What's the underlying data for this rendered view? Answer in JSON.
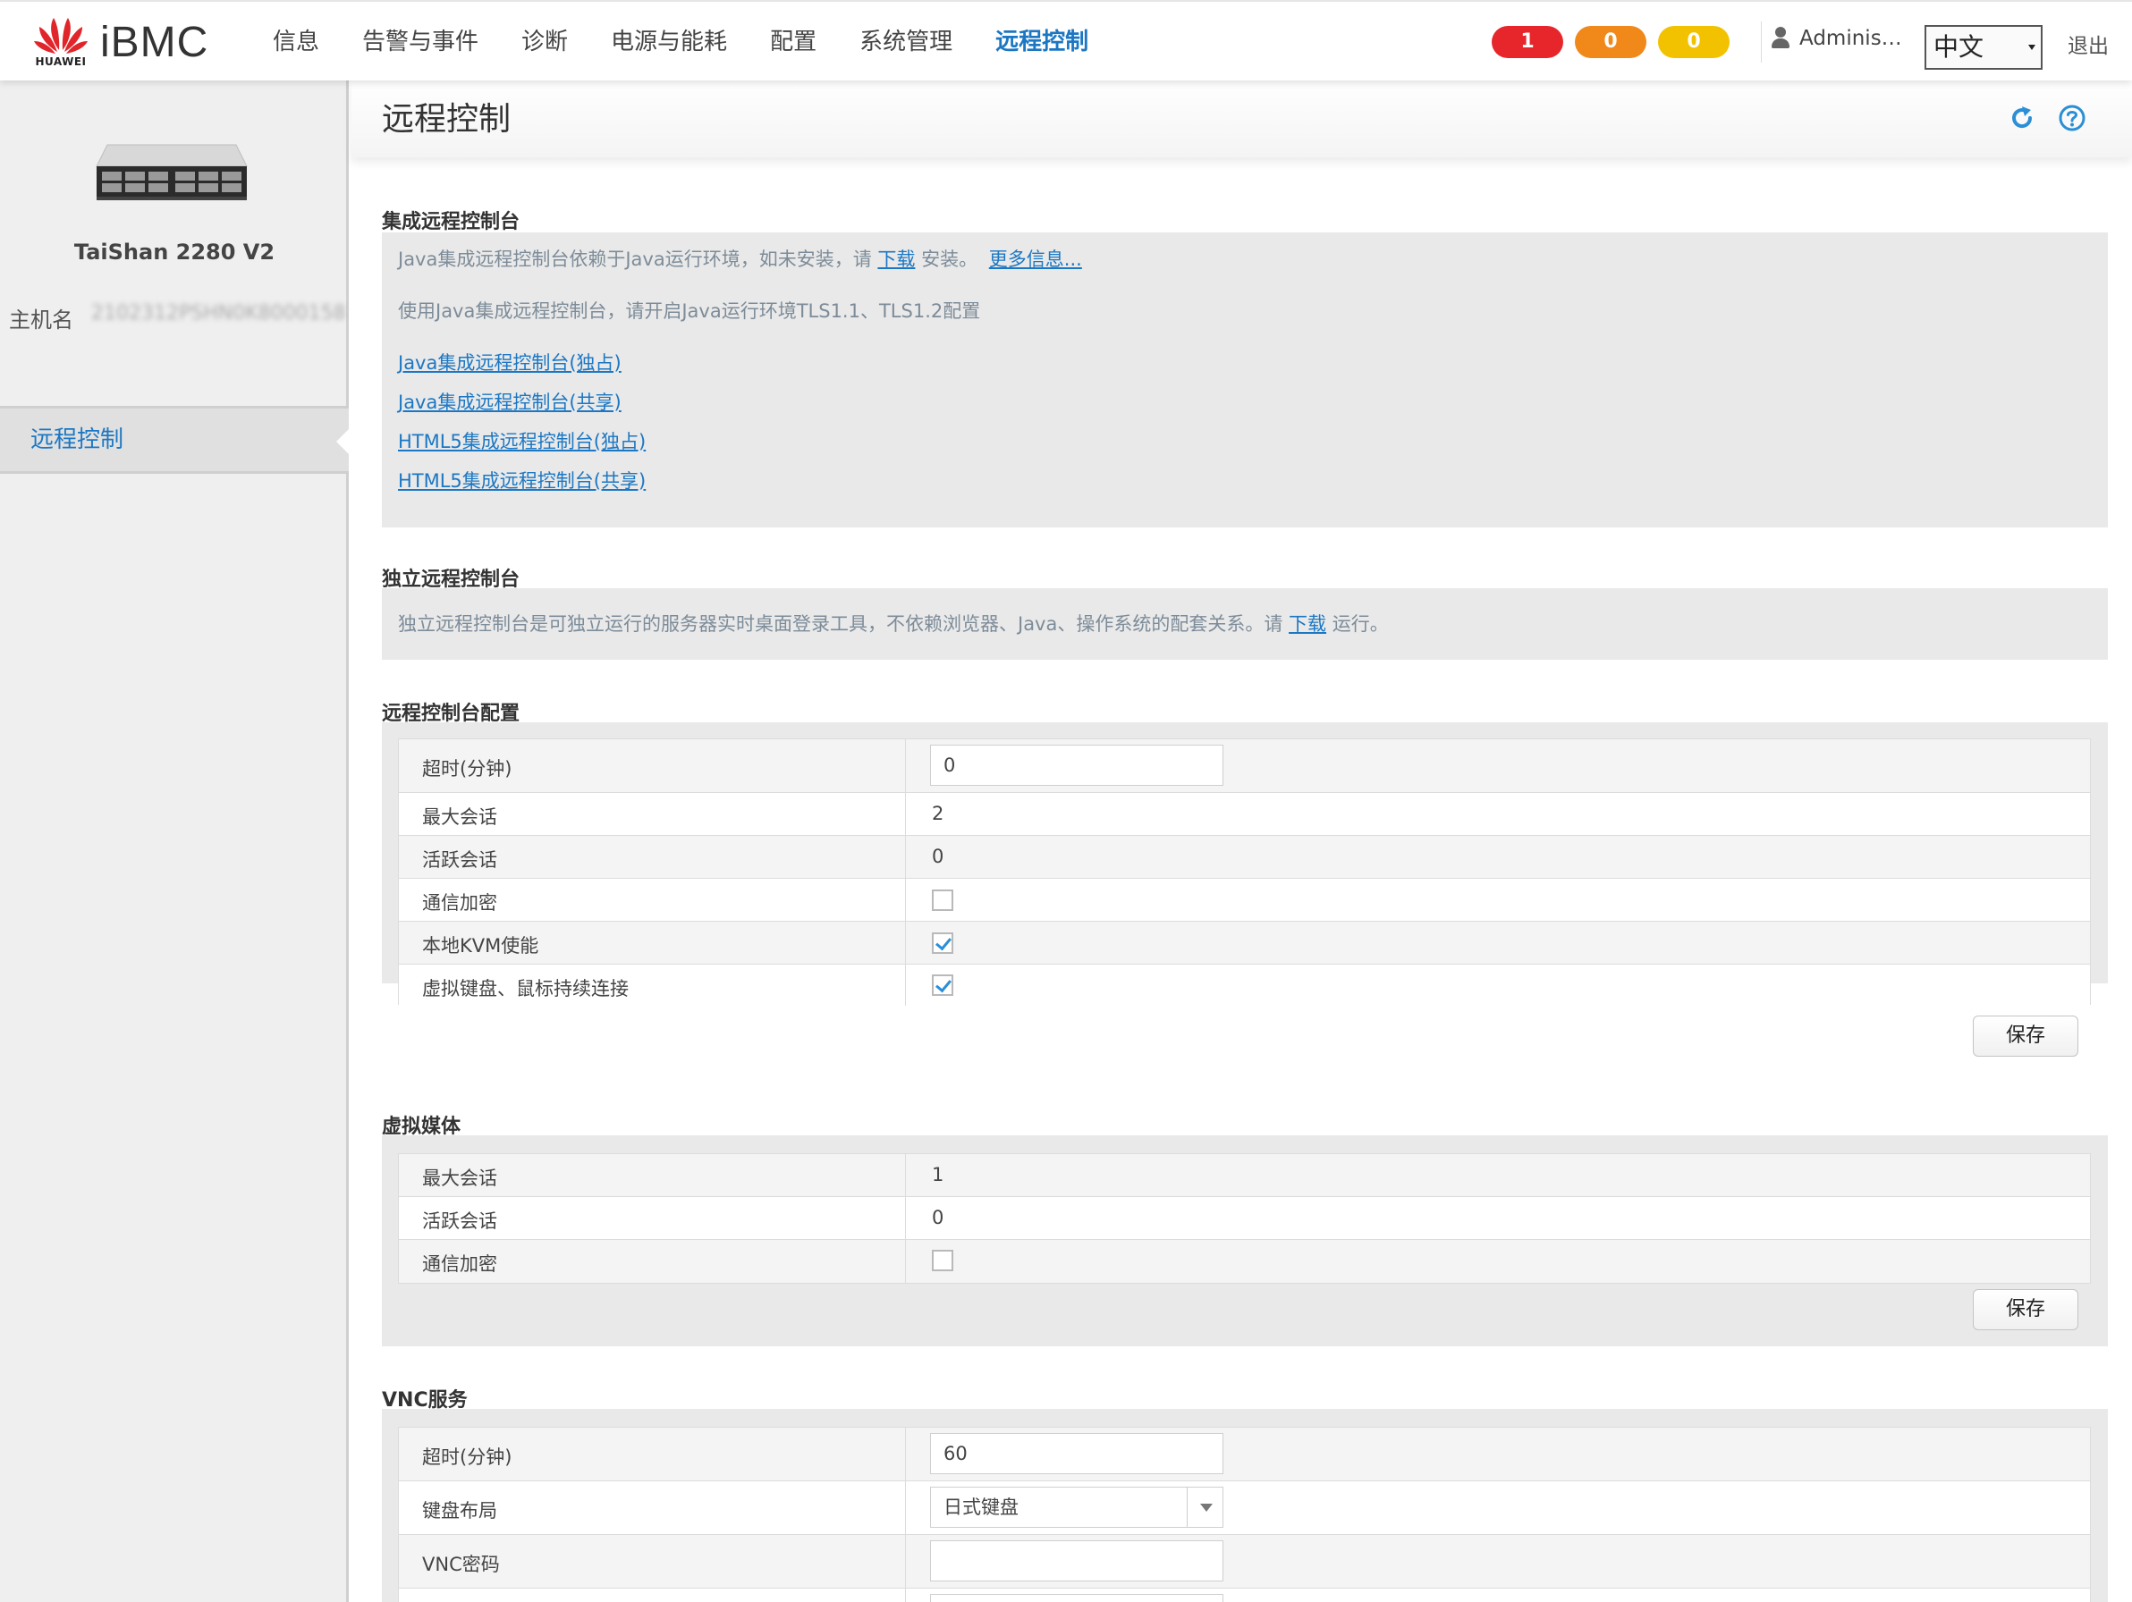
{
  "header": {
    "brand_small": "HUAWEI",
    "brand": "iBMC",
    "nav": [
      "信息",
      "告警与事件",
      "诊断",
      "电源与能耗",
      "配置",
      "系统管理",
      "远程控制"
    ],
    "active_nav_index": 6,
    "alerts": {
      "critical": "1",
      "major": "0",
      "minor": "0"
    },
    "user": "Adminis…",
    "language": "中文",
    "logout": "退出"
  },
  "colors": {
    "accent": "#1c77c3",
    "critical": "#e6262b",
    "major": "#f0881a",
    "minor": "#f2c200"
  },
  "sidebar": {
    "model": "TaiShan 2280 V2",
    "hostname_label": "主机名",
    "hostname_value": "2102312PSHN0K8000158",
    "nav_item": "远程控制"
  },
  "page": {
    "title": "远程控制"
  },
  "integrated": {
    "title": "集成远程控制台",
    "line1_prefix": "Java集成远程控制台依赖于Java运行环境，如未安装，请",
    "line1_link": "下载",
    "line1_suffix": "安装。",
    "more_info": "更多信息...",
    "line2": "使用Java集成远程控制台，请开启Java运行环境TLS1.1、TLS1.2配置",
    "links": [
      "Java集成远程控制台(独占)",
      "Java集成远程控制台(共享)",
      "HTML5集成远程控制台(独占)",
      "HTML5集成远程控制台(共享)"
    ]
  },
  "standalone": {
    "title": "独立远程控制台",
    "text_prefix": "独立远程控制台是可独立运行的服务器实时桌面登录工具，不依赖浏览器、Java、操作系统的配套关系。请",
    "link": "下载",
    "text_suffix": "运行。"
  },
  "console_config": {
    "title": "远程控制台配置",
    "rows": [
      {
        "label": "超时(分钟)",
        "value": "0"
      },
      {
        "label": "最大会话",
        "value": "2"
      },
      {
        "label": "活跃会话",
        "value": "0"
      },
      {
        "label": "通信加密",
        "checked": false
      },
      {
        "label": "本地KVM使能",
        "checked": true
      },
      {
        "label": "虚拟键盘、鼠标持续连接",
        "checked": true
      }
    ],
    "save": "保存"
  },
  "virtual_media": {
    "title": "虚拟媒体",
    "rows": [
      {
        "label": "最大会话",
        "value": "1"
      },
      {
        "label": "活跃会话",
        "value": "0"
      },
      {
        "label": "通信加密",
        "checked": false
      }
    ],
    "save": "保存"
  },
  "vnc": {
    "title": "VNC服务",
    "rows": [
      {
        "label": "超时(分钟)",
        "value": "60"
      },
      {
        "label": "键盘布局",
        "value": "日式键盘"
      },
      {
        "label": "VNC密码",
        "value": ""
      }
    ]
  },
  "icons": {
    "refresh": "refresh-icon",
    "help": "help-icon",
    "user": "user-icon"
  }
}
